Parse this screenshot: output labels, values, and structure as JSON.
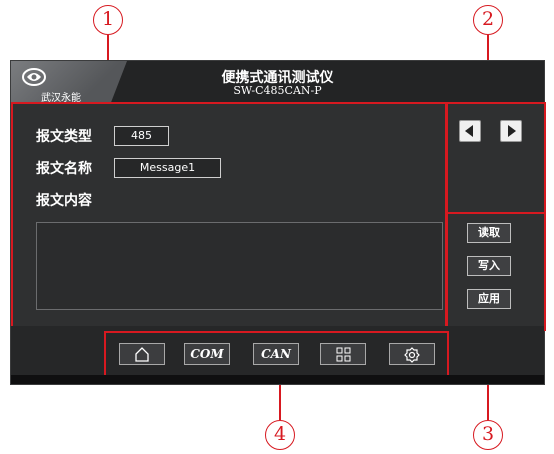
{
  "callouts": {
    "c1": "1",
    "c2": "2",
    "c3": "3",
    "c4": "4"
  },
  "header": {
    "title": "便携式通讯测试仪",
    "subtitle": "SW-C485CAN-P",
    "logo_text": "武汉永能"
  },
  "form": {
    "type_label": "报文类型",
    "type_value": "485",
    "name_label": "报文名称",
    "name_value": "Message1",
    "content_label": "报文内容"
  },
  "side_buttons": {
    "read": "读取",
    "write": "写入",
    "apply": "应用"
  },
  "nav": {
    "com": "COM",
    "can": "CAN"
  },
  "colors": {
    "accent": "#d71920",
    "screen_bg": "#2f3031"
  },
  "icons": [
    "home-icon",
    "grid-icon",
    "gear-icon",
    "arrow-left-icon",
    "arrow-right-icon"
  ]
}
